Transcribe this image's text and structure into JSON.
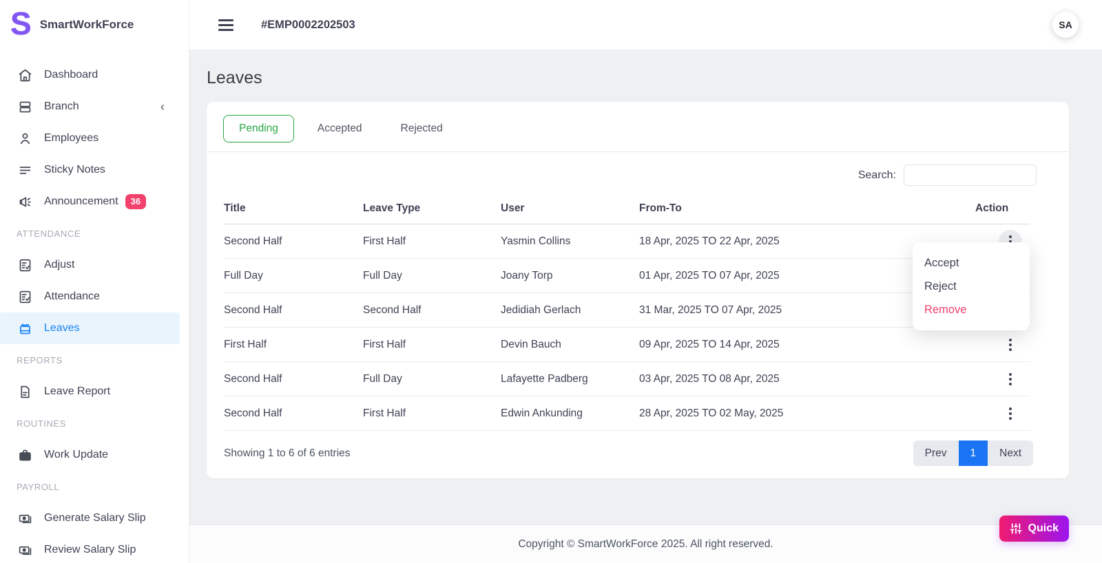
{
  "brand": {
    "logo_letter": "S",
    "name": "SmartWorkForce"
  },
  "header": {
    "employee_id": "#EMP0002202503",
    "avatar_initials": "SA"
  },
  "sidebar": {
    "items": [
      {
        "label": "Dashboard"
      },
      {
        "label": "Branch"
      },
      {
        "label": "Employees"
      },
      {
        "label": "Sticky Notes"
      },
      {
        "label": "Announcement",
        "badge": "36"
      },
      {
        "label": "Adjust"
      },
      {
        "label": "Attendance"
      },
      {
        "label": "Leaves"
      },
      {
        "label": "Leave Report"
      },
      {
        "label": "Work Update"
      },
      {
        "label": "Generate Salary Slip"
      },
      {
        "label": "Review Salary Slip"
      }
    ],
    "sections": {
      "attendance": "ATTENDANCE",
      "reports": "REPORTS",
      "routines": "ROUTINES",
      "payroll": "PAYROLL"
    }
  },
  "page": {
    "title": "Leaves"
  },
  "tabs": [
    {
      "label": "Pending",
      "active": true
    },
    {
      "label": "Accepted",
      "active": false
    },
    {
      "label": "Rejected",
      "active": false
    }
  ],
  "search": {
    "label": "Search:",
    "value": ""
  },
  "table": {
    "columns": [
      "Title",
      "Leave Type",
      "User",
      "From-To",
      "Action"
    ],
    "rows": [
      {
        "title": "Second Half",
        "leave_type": "First Half",
        "user": "Yasmin Collins",
        "from_to": "18 Apr, 2025 TO 22 Apr, 2025"
      },
      {
        "title": "Full Day",
        "leave_type": "Full Day",
        "user": "Joany Torp",
        "from_to": "01 Apr, 2025 TO 07 Apr, 2025"
      },
      {
        "title": "Second Half",
        "leave_type": "Second Half",
        "user": "Jedidiah Gerlach",
        "from_to": "31 Mar, 2025 TO 07 Apr, 2025"
      },
      {
        "title": "First Half",
        "leave_type": "First Half",
        "user": "Devin Bauch",
        "from_to": "09 Apr, 2025 TO 14 Apr, 2025"
      },
      {
        "title": "Second Half",
        "leave_type": "Full Day",
        "user": "Lafayette Padberg",
        "from_to": "03 Apr, 2025 TO 08 Apr, 2025"
      },
      {
        "title": "Second Half",
        "leave_type": "First Half",
        "user": "Edwin Ankunding",
        "from_to": "28 Apr, 2025 TO 02 May, 2025"
      }
    ]
  },
  "dropdown": {
    "items": [
      {
        "label": "Accept"
      },
      {
        "label": "Reject"
      },
      {
        "label": "Remove"
      }
    ]
  },
  "pagination": {
    "summary": "Showing 1 to 6 of 6 entries",
    "prev": "Prev",
    "page": "1",
    "next": "Next"
  },
  "footer": {
    "copyright": "Copyright © SmartWorkForce 2025. All right reserved."
  },
  "quick_button": {
    "label": "Quick"
  },
  "colors": {
    "brand_purple": "#8356f1",
    "accent_blue": "#1b74f3",
    "active_item_blue": "#1b84f5",
    "success_green": "#28a745",
    "danger_pink": "#f1416c",
    "quick_gradient_start": "#f01a70",
    "quick_gradient_end": "#9c15ef",
    "page_background": "#eef0f2"
  }
}
